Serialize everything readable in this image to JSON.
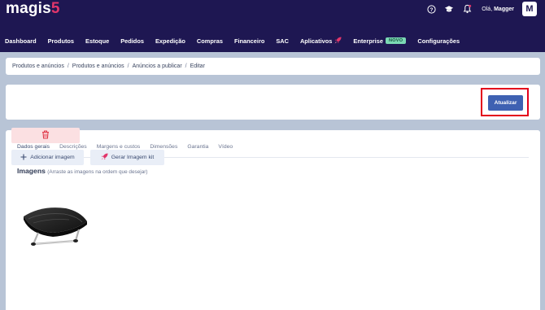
{
  "brand": {
    "name": "magis",
    "number": "5",
    "accent": "#e2366b"
  },
  "topbar": {
    "icons": [
      "help-icon",
      "graduation-cap-icon",
      "bell-icon"
    ],
    "greeting_prefix": "Olá,",
    "user_name": "Magger",
    "avatar_initial": "M"
  },
  "nav": {
    "items": [
      "Dashboard",
      "Produtos",
      "Estoque",
      "Pedidos",
      "Expedição",
      "Compras",
      "Financeiro",
      "SAC",
      "Aplicativos",
      "Enterprise",
      "Configurações"
    ],
    "enterprise_badge": "NOVO"
  },
  "breadcrumb": [
    "Produtos e anúncios",
    "Produtos e anúncios",
    "Anúncios a publicar",
    "Editar"
  ],
  "breadcrumb_sep": "/",
  "actions": {
    "update_label": "Atualizar",
    "highlight_color": "#e3001b"
  },
  "tabs": [
    "Dados gerais",
    "Descrições",
    "Margens e custos",
    "Dimensões",
    "Garantia",
    "Vídeo"
  ],
  "images": {
    "title": "Imagens",
    "subtitle": "(Arraste as imagens na ordem que desejar)",
    "add_label": "Adicionar imagem",
    "kit_label": "Gerar Imagem kit"
  },
  "colors": {
    "topbar": "#1e1752",
    "primary_button": "#3f61b2",
    "background": "#b8c4d6"
  }
}
